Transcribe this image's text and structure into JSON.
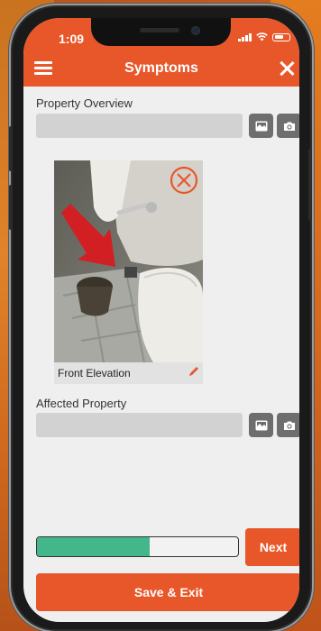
{
  "status_bar": {
    "time": "1:09"
  },
  "header": {
    "title": "Symptoms"
  },
  "property_overview": {
    "label": "Property Overview",
    "value": ""
  },
  "photo": {
    "caption": "Front Elevation"
  },
  "affected_property": {
    "label": "Affected Property",
    "value": ""
  },
  "progress": {
    "fraction": 0.56
  },
  "buttons": {
    "next_label": "Next",
    "save_exit_label": "Save & Exit"
  },
  "colors": {
    "accent": "#e8572a",
    "progress": "#43b68c",
    "field": "#d2d2d2",
    "icon_button": "#6e6e6e"
  },
  "icons": [
    "menu-icon",
    "close-icon",
    "gallery-icon",
    "camera-icon",
    "remove-photo-icon",
    "edit-icon"
  ]
}
